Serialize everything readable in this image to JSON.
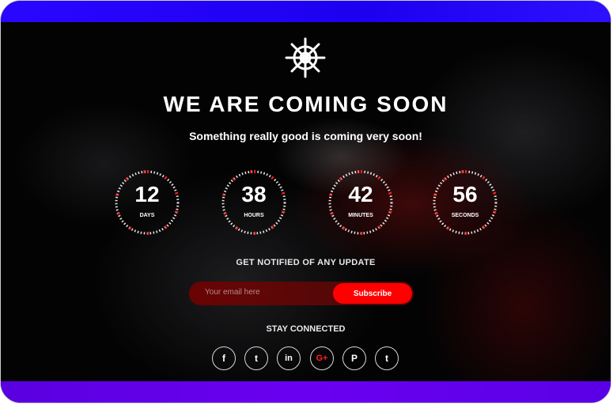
{
  "title": "WE ARE COMING SOON",
  "subtitle": "Something really good is coming very soon!",
  "countdown": [
    {
      "value": "12",
      "unit": "DAYS"
    },
    {
      "value": "38",
      "unit": "HOURS"
    },
    {
      "value": "42",
      "unit": "MINUTES"
    },
    {
      "value": "56",
      "unit": "SECONDS"
    }
  ],
  "notify_label": "GET NOTIFIED OF ANY UPDATE",
  "email_placeholder": "Your email here",
  "subscribe_label": "Subscribe",
  "stay_label": "STAY CONNECTED",
  "social": [
    {
      "icon": "facebook-icon",
      "glyph": "f"
    },
    {
      "icon": "twitter-icon",
      "glyph": "t"
    },
    {
      "icon": "linkedin-icon",
      "glyph": "in"
    },
    {
      "icon": "google-plus-icon",
      "glyph": "G+"
    },
    {
      "icon": "pinterest-icon",
      "glyph": "P"
    },
    {
      "icon": "tumblr-icon",
      "glyph": "t"
    }
  ],
  "colors": {
    "accent": "#ff0000",
    "top_bar": "#1d00f0",
    "bottom_bar": "#6a00f0"
  }
}
